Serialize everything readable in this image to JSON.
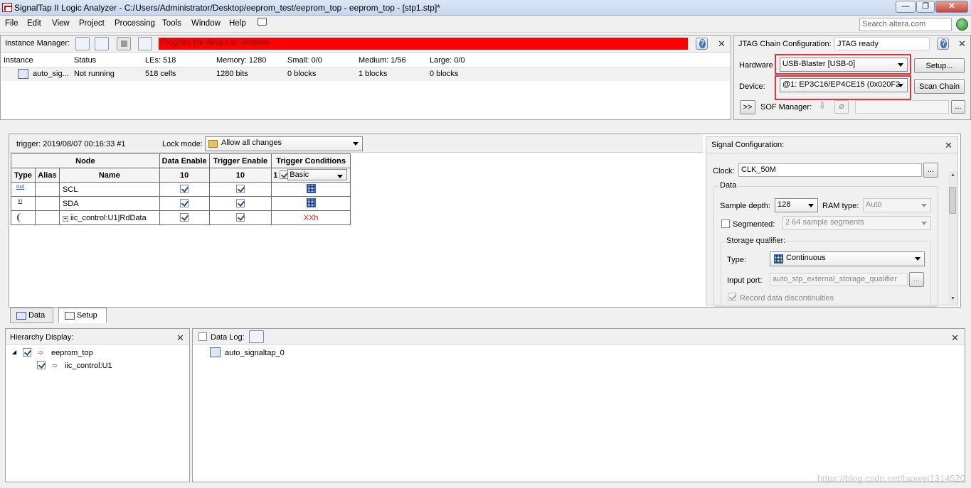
{
  "window": {
    "title": "SignalTap II Logic Analyzer - C:/Users/Administrator/Desktop/eeprom_test/eeprom_top - eeprom_top - [stp1.stp]*",
    "min": "—",
    "max": "❐",
    "close": "✕"
  },
  "menu": {
    "items": [
      "File",
      "Edit",
      "View",
      "Project",
      "Processing",
      "Tools",
      "Window",
      "Help"
    ],
    "search_placeholder": "Search altera.com"
  },
  "instance_manager": {
    "label": "Instance Manager:",
    "status_message": "Program the device to continue",
    "status_color": "#ff0000",
    "headers": [
      "Instance",
      "Status",
      "LEs: 518",
      "Memory: 1280",
      "Small: 0/0",
      "Medium: 1/56",
      "Large: 0/0"
    ],
    "row": [
      "auto_sig...",
      "Not running",
      "518 cells",
      "1280 bits",
      "0 blocks",
      "1 blocks",
      "0 blocks"
    ]
  },
  "jtag": {
    "label": "JTAG Chain Configuration:",
    "status": "JTAG ready",
    "hardware_label": "Hardware",
    "hardware_value": "USB-Blaster [USB-0]",
    "setup_button": "Setup...",
    "device_label": "Device:",
    "device_value": "@1: EP3C16/EP4CE15 (0x020F2",
    "scan_button": "Scan Chain",
    "expand_button": ">>",
    "sof_label": "SOF Manager:",
    "browse_button": "..."
  },
  "setup": {
    "trigger_label": "trigger: 2019/08/07 00:16:33  #1",
    "lock_mode_label": "Lock mode:",
    "lock_mode_value": "Allow all changes",
    "table": {
      "group_headers": [
        "Node",
        "Data Enable",
        "Trigger Enable",
        "Trigger Conditions"
      ],
      "sub_headers": [
        "Type",
        "Alias",
        "Name",
        "10",
        "10",
        "1"
      ],
      "trigger_condition_mode": "Basic",
      "rows": [
        {
          "type_icon": "out",
          "name": "SCL",
          "trigger": ""
        },
        {
          "type_icon": "io",
          "name": "SDA",
          "trigger": ""
        },
        {
          "type_icon": "bus",
          "name": "iic_control:U1|RdData",
          "trigger": "XXh"
        }
      ]
    }
  },
  "signal_config": {
    "title": "Signal Configuration:",
    "clock_label": "Clock:",
    "clock_value": "CLK_50M",
    "data_group": "Data",
    "sample_depth_label": "Sample depth:",
    "sample_depth_value": "128",
    "ram_type_label": "RAM type:",
    "ram_type_value": "Auto",
    "segmented_label": "Segmented:",
    "segmented_value": "2  64 sample segments",
    "storage_qualifier_label": "Storage qualifier:",
    "type_label": "Type:",
    "type_value": "Continuous",
    "input_port_label": "Input port:",
    "input_port_value": "auto_stp_external_storage_qualifier",
    "record_label": "Record data discontinuities"
  },
  "tabs": [
    "Data",
    "Setup"
  ],
  "hierarchy": {
    "title": "Hierarchy Display:",
    "items": [
      "eeprom_top",
      "iic_control:U1"
    ]
  },
  "data_log": {
    "title": "Data Log:",
    "items": [
      "auto_signaltap_0"
    ]
  },
  "watermark": "https://blog.csdn.net/taowei1314520"
}
